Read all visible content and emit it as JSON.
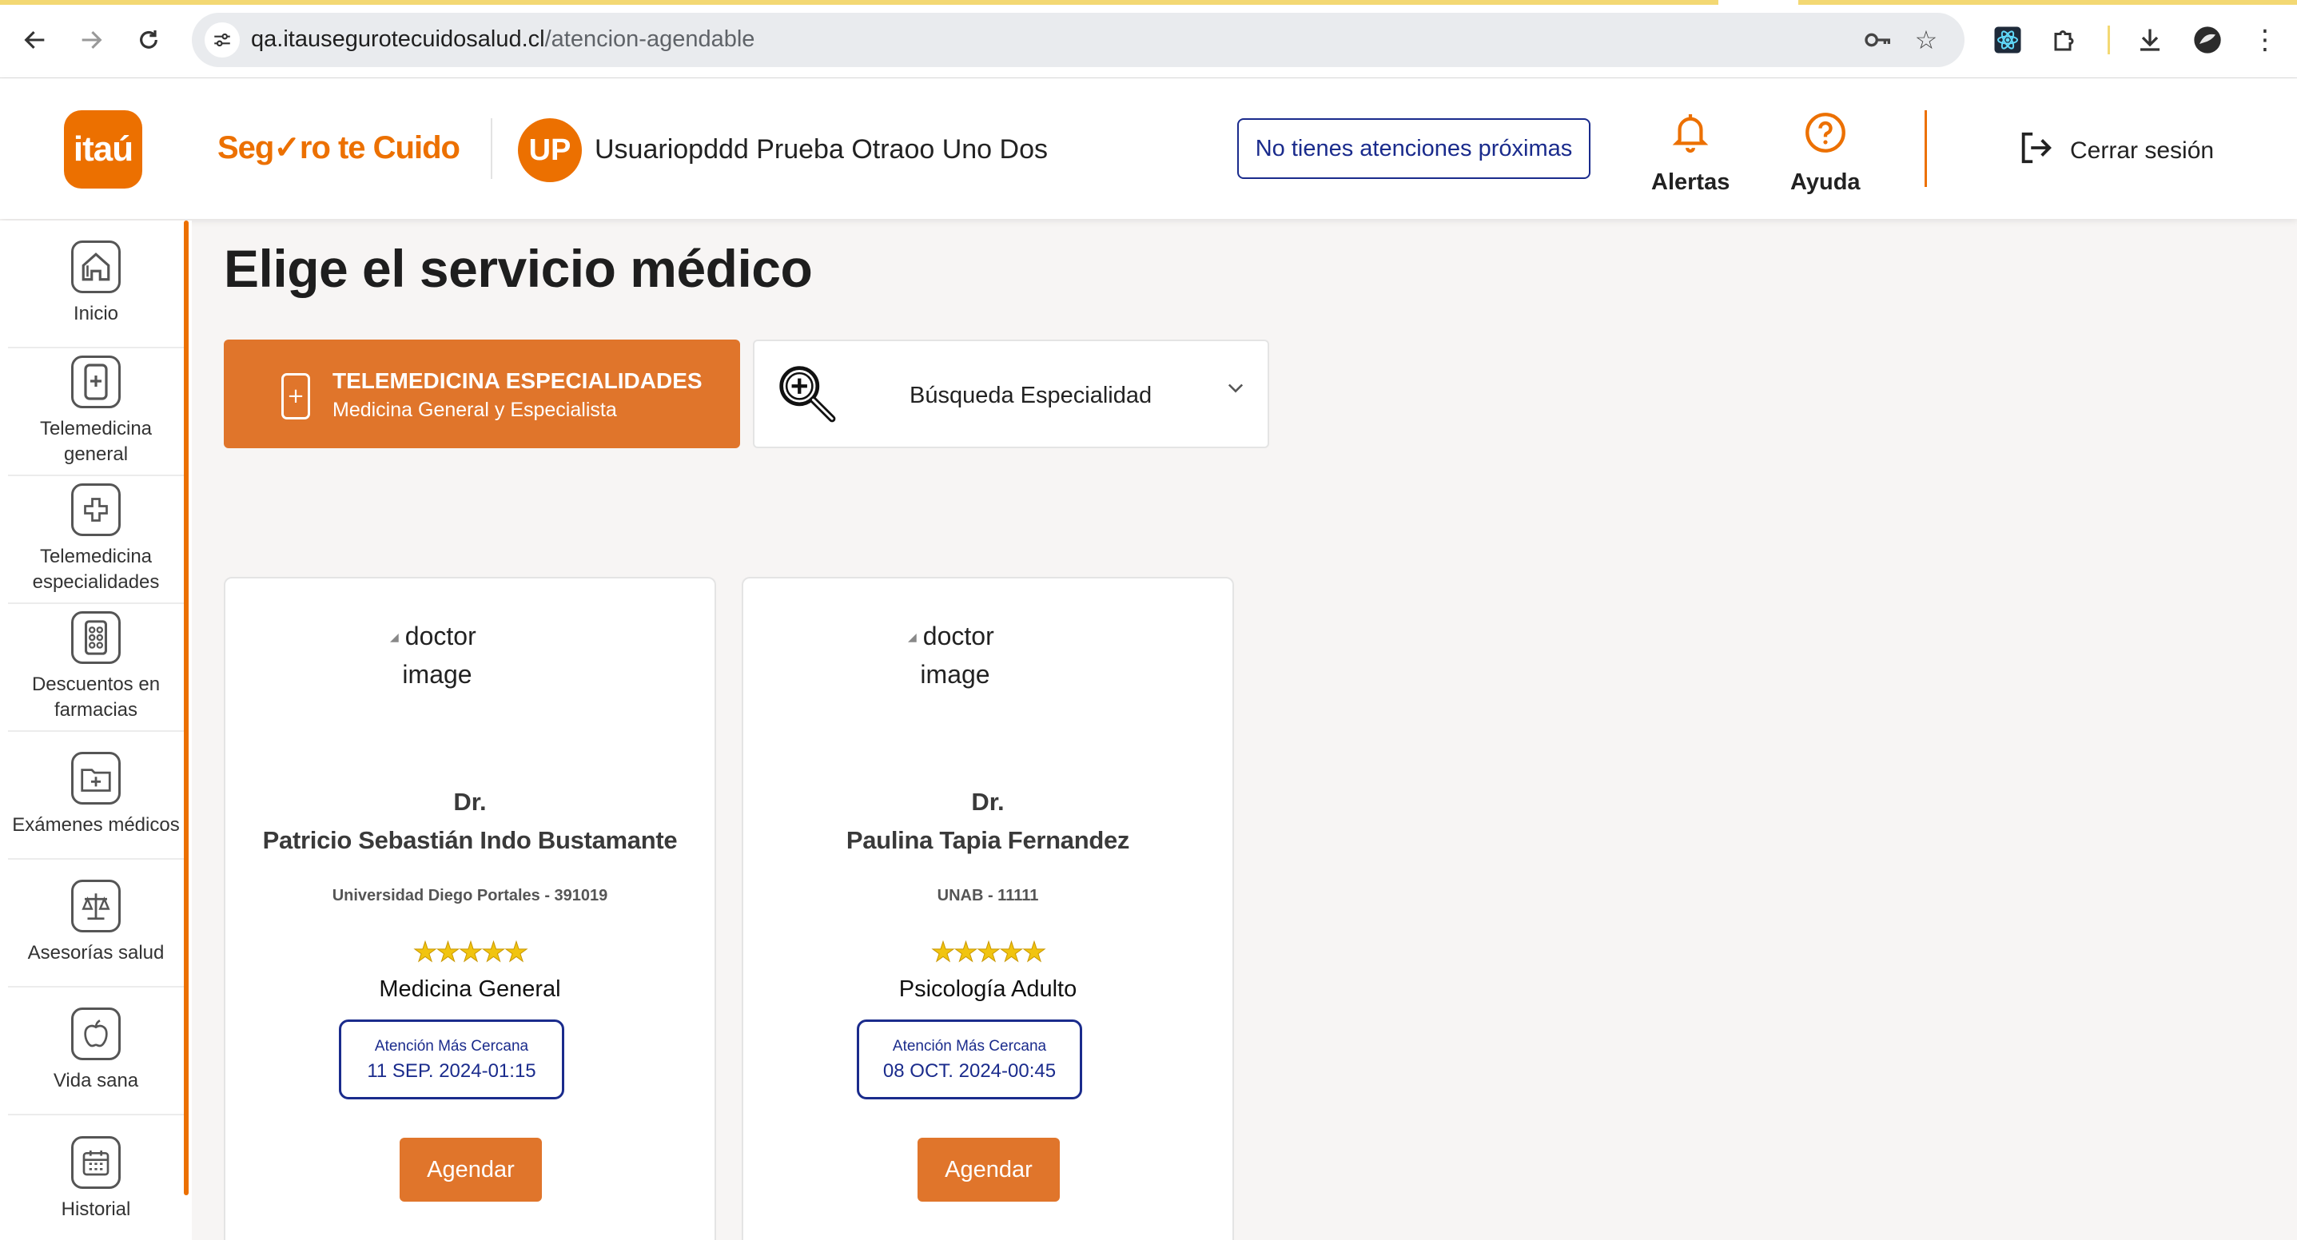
{
  "browser": {
    "url_host": "qa.itausegurotecuidosalud.cl",
    "url_path": "/atencion-agendable",
    "back_icon": "arrow-left-icon",
    "forward_icon": "arrow-right-icon",
    "reload_icon": "reload-icon",
    "colors": {
      "top_accent": "#f3d873"
    }
  },
  "header": {
    "logo_text": "itaú",
    "brand_text": "Seg✓ro te Cuido",
    "avatar_initials": "UP",
    "user_name": "Usuariopddd Prueba Otraoo Uno Dos",
    "next_appointments": "No tienes atenciones próximas",
    "alerts_label": "Alertas",
    "help_label": "Ayuda",
    "logout_label": "Cerrar sesión",
    "colors": {
      "brand": "#ec7000",
      "navy": "#1a2b8c"
    }
  },
  "sidebar": {
    "items": [
      {
        "label": "Inicio",
        "icon": "home-icon"
      },
      {
        "label": "Telemedicina general",
        "icon": "phone-plus-icon"
      },
      {
        "label": "Telemedicina especialidades",
        "icon": "plus-icon"
      },
      {
        "label": "Descuentos en farmacias",
        "icon": "pills-icon"
      },
      {
        "label": "Exámenes médicos",
        "icon": "medical-folder-icon"
      },
      {
        "label": "Asesorías salud",
        "icon": "scales-icon"
      },
      {
        "label": "Vida sana",
        "icon": "apple-icon"
      },
      {
        "label": "Historial",
        "icon": "calendar-icon"
      }
    ]
  },
  "main": {
    "title": "Elige el servicio médico",
    "service_tab": {
      "title": "TELEMEDICINA ESPECIALIDADES",
      "subtitle": "Medicina General y Especialista"
    },
    "search": {
      "label": "Búsqueda Especialidad"
    },
    "doctors": [
      {
        "image_alt_1": "doctor",
        "image_alt_2": "image",
        "prefix": "Dr.",
        "name": "Patricio Sebastián Indo Bustamante",
        "university": "Universidad Diego Portales - 391019",
        "rating": "5 / 5",
        "specialty": "Medicina General",
        "appointment_label": "Atención Más Cercana",
        "appointment_date": "11 SEP. 2024-01:15",
        "book_label": "Agendar"
      },
      {
        "image_alt_1": "doctor",
        "image_alt_2": "image",
        "prefix": "Dr.",
        "name": "Paulina Tapia Fernandez",
        "university": "UNAB - 11111",
        "rating": "5 / 5",
        "specialty": "Psicología Adulto",
        "appointment_label": "Atención Más Cercana",
        "appointment_date": "08 OCT. 2024-00:45",
        "book_label": "Agendar"
      }
    ]
  }
}
